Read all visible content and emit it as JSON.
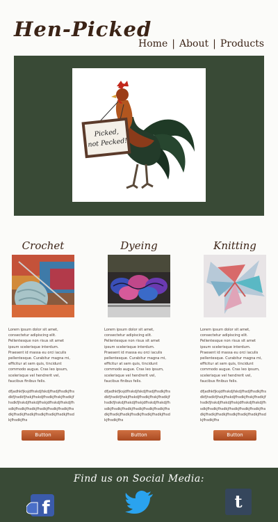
{
  "header": {
    "logo": "Hen-Picked",
    "nav": [
      {
        "label": "Home"
      },
      {
        "label": "About"
      },
      {
        "label": "Products"
      }
    ],
    "separator": "|"
  },
  "hero": {
    "sign_line1": "Picked,",
    "sign_line2": "not Pecked!"
  },
  "columns": [
    {
      "title": "Crochet",
      "text": "Lorem ipsum dolor sit amet, consectetur adipiscing elit. Pellentesque non risus sit amet ipsum scelerisque interdum. Praesent id massa eu orci iaculis pellentesque. Curabitur magna mi, efficitur at sem quis, tincidunt commodo augue. Cras leo ipsum, scelerisque vel hendrerit vel, faucibus finibus felis.",
      "filler": "dfjadhkfjksjdfhskdjfskdjfhsdjfhsdkjfhsdkfjhsdkfjhskjfhskdjfhsdkjfhskjfhsdkjfhsdkfjhskdjfhskdjfhskjdfhskdjfhskdjfhsdkjfhsdkjfhsdkjfhsdkjfhsdkjfhsdkjfhsdkjfhsdkjfhsdkjfhsdkjfhsdkjfhsdkjfhsdkjfhsdkjfhs",
      "button": "Button"
    },
    {
      "title": "Dyeing",
      "text": "Lorem ipsum dolor sit amet, consectetur adipiscing elit. Pellentesque non risus sit amet ipsum scelerisque interdum. Praesent id massa eu orci iaculis pellentesque. Curabitur magna mi, efficitur at sem quis, tincidunt commodo augue. Cras leo ipsum, scelerisque vel hendrerit vel, faucibus finibus felis.",
      "filler": "dfjadhkfjksjdfhskdjfskdjfhsdjfhsdkjfhsdkfjhsdkfjhskjfhskdjfhsdkjfhskjfhsdkjfhsdkfjhskdjfhskdjfhskjdfhskdjfhskdjfhsdkjfhsdkjfhsdkjfhsdkjfhsdkjfhsdkjfhsdkjfhsdkjfhsdkjfhsdkjfhsdkjfhsdkjfhsdkjfhsdkjfhs",
      "button": "Button"
    },
    {
      "title": "Knitting",
      "text": "Lorem ipsum dolor sit amet, consectetur adipiscing elit. Pellentesque non risus sit amet ipsum scelerisque interdum. Praesent id massa eu orci iaculis pellentesque. Curabitur magna mi, efficitur at sem quis, tincidunt commodo augue. Cras leo ipsum, scelerisque vel hendrerit vel, faucibus finibus felis.",
      "filler": "dfjadhkfjksjdfhskdjfskdjfhsdjfhsdkjfhsdkfjhsdkfjhskjfhskdjfhsdkjfhskjfhsdkjfhsdkfjhskdjfhskdjfhskjdfhskdjfhskdjfhsdkjfhsdkjfhsdkjfhsdkjfhsdkjfhsdkjfhsdkjfhsdkjfhsdkjfhsdkjfhsdkjfhsdkjfhsdkjfhsdkjfhs",
      "button": "Button"
    }
  ],
  "footer": {
    "title": "Find us on Social Media:",
    "icons": [
      "facebook-icon",
      "twitter-icon",
      "tumblr-icon"
    ],
    "tumblr_glyph": "t"
  },
  "colors": {
    "green": "#394a36",
    "brown": "#3b2316",
    "button": "#bf5e32"
  }
}
